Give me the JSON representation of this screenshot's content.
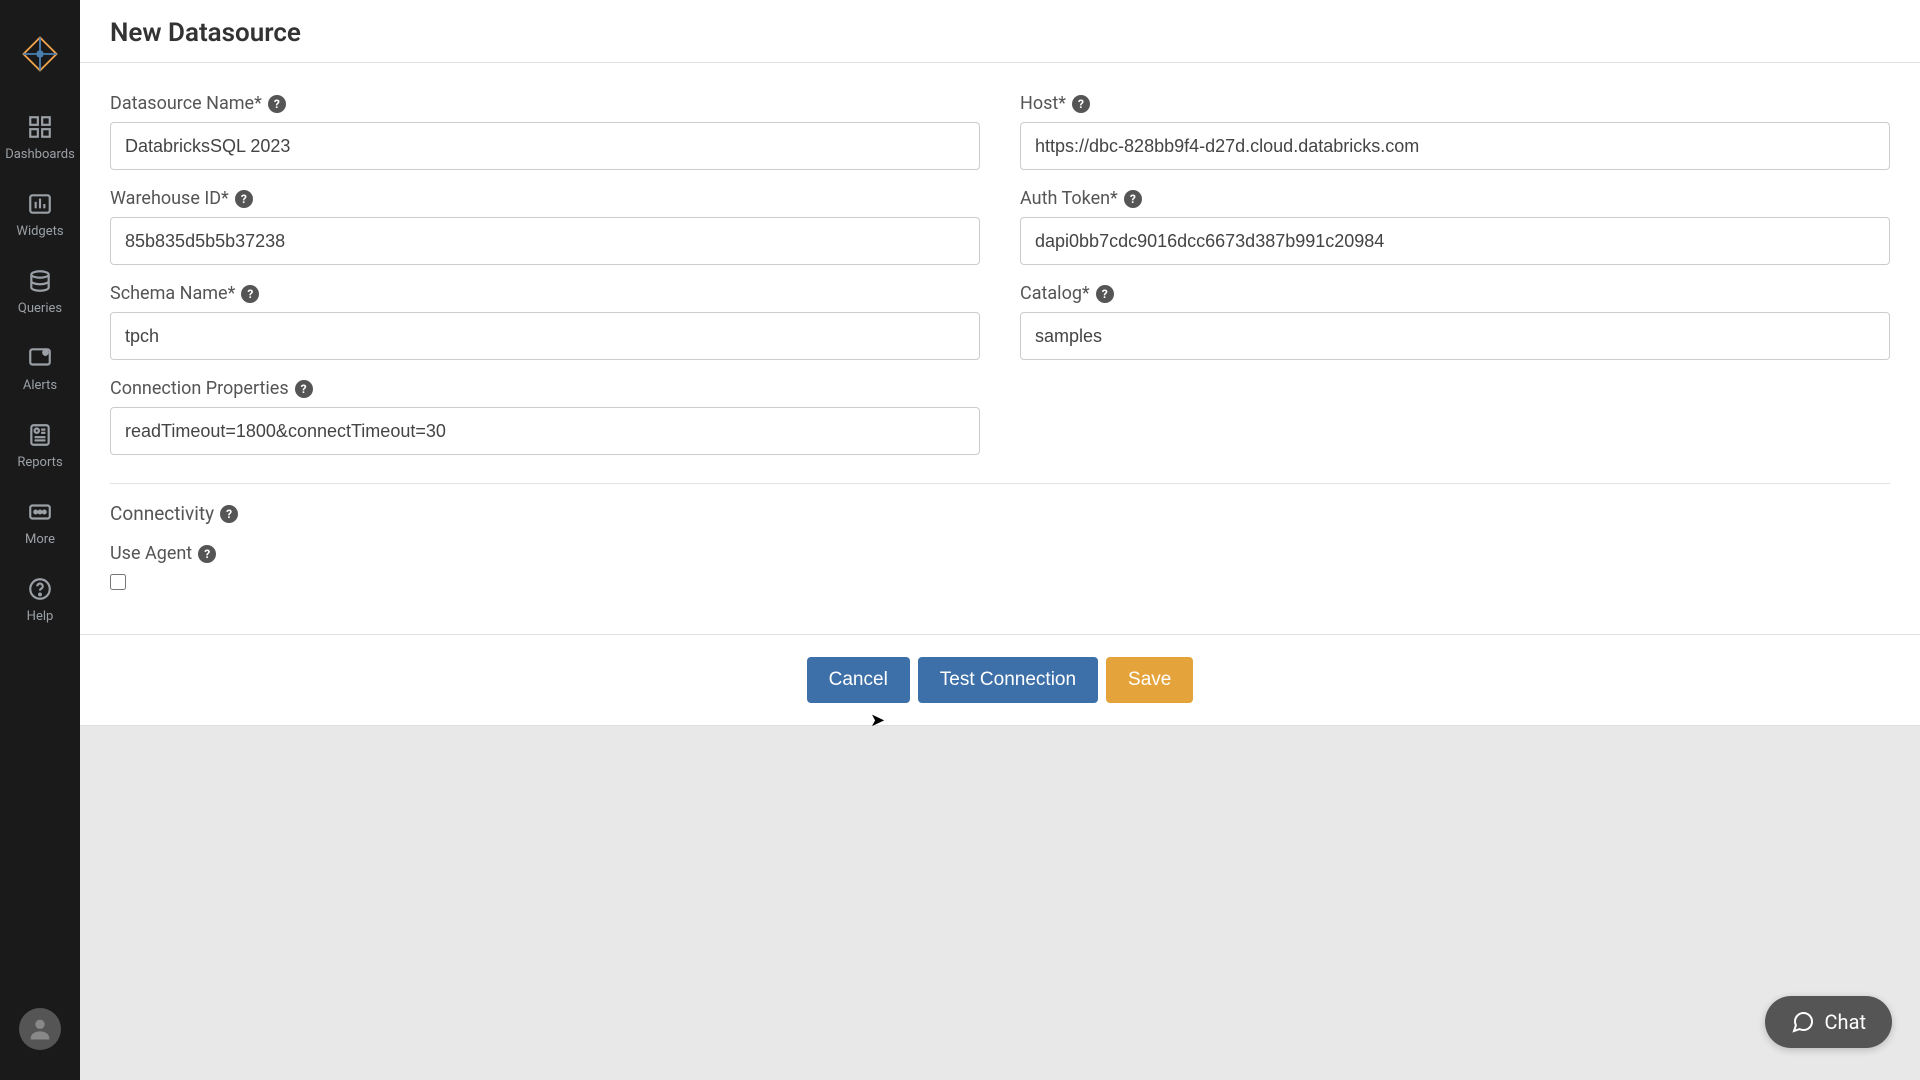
{
  "sidebar": {
    "items": [
      {
        "label": "Dashboards"
      },
      {
        "label": "Widgets"
      },
      {
        "label": "Queries"
      },
      {
        "label": "Alerts"
      },
      {
        "label": "Reports"
      },
      {
        "label": "More"
      },
      {
        "label": "Help"
      }
    ]
  },
  "page": {
    "title": "New Datasource"
  },
  "form": {
    "datasource_name": {
      "label": "Datasource Name*",
      "value": "DatabricksSQL 2023"
    },
    "host": {
      "label": "Host*",
      "value": "https://dbc-828bb9f4-d27d.cloud.databricks.com"
    },
    "warehouse_id": {
      "label": "Warehouse ID*",
      "value": "85b835d5b5b37238"
    },
    "auth_token": {
      "label": "Auth Token*",
      "value": "dapi0bb7cdc9016dcc6673d387b991c20984"
    },
    "schema_name": {
      "label": "Schema Name*",
      "value": "tpch"
    },
    "catalog": {
      "label": "Catalog*",
      "value": "samples"
    },
    "connection_props": {
      "label": "Connection Properties",
      "value": "readTimeout=1800&connectTimeout=30"
    },
    "connectivity": {
      "label": "Connectivity"
    },
    "use_agent": {
      "label": "Use Agent",
      "checked": false
    }
  },
  "footer": {
    "cancel": "Cancel",
    "test": "Test Connection",
    "save": "Save"
  },
  "chat": {
    "label": "Chat"
  },
  "colors": {
    "sidebar_bg": "#1a1a1a",
    "primary_btn": "#3d6fa8",
    "accent_btn": "#e5a33c"
  }
}
